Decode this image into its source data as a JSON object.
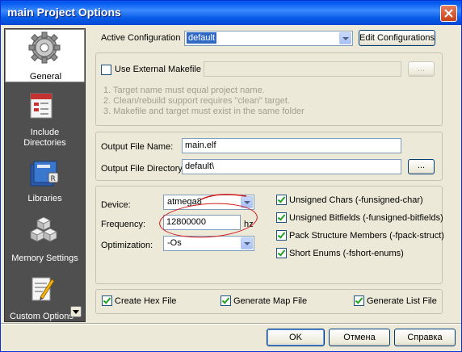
{
  "window": {
    "title": "main Project Options"
  },
  "sidebar": {
    "items": [
      {
        "label": "General",
        "icon": "gear-icon"
      },
      {
        "label": "Include Directories",
        "label_line1": "Include",
        "label_line2": "Directories",
        "icon": "include-directories-icon"
      },
      {
        "label": "Libraries",
        "icon": "libraries-icon"
      },
      {
        "label": "Memory Settings",
        "icon": "memory-settings-icon"
      },
      {
        "label": "Custom Options",
        "icon": "custom-options-icon"
      }
    ]
  },
  "config": {
    "active_label": "Active Configuration",
    "active_value": "default",
    "edit_button": "Edit Configurations"
  },
  "makefile": {
    "use_external_label": "Use External Makefile",
    "use_external_checked": false,
    "path_value": "",
    "browse_label": "...",
    "notes": [
      "1. Target name must equal project name.",
      "2. Clean/rebuild support requires  \"clean\" target.",
      "3. Makefile and target must exist in the same folder"
    ]
  },
  "output": {
    "file_name_label": "Output File Name:",
    "file_name_value": "main.elf",
    "directory_label": "Output File Directory:",
    "directory_value": "default\\",
    "browse_label": "..."
  },
  "device": {
    "device_label": "Device:",
    "device_value": "atmega8",
    "frequency_label": "Frequency:",
    "frequency_value": "12800000",
    "frequency_unit": "hz",
    "optimization_label": "Optimization:",
    "optimization_value": "-Os"
  },
  "compiler_flags": [
    {
      "label": "Unsigned Chars (-funsigned-char)",
      "checked": true
    },
    {
      "label": "Unsigned Bitfields (-funsigned-bitfields)",
      "checked": true
    },
    {
      "label": "Pack Structure Members (-fpack-struct)",
      "checked": true
    },
    {
      "label": "Short Enums (-fshort-enums)",
      "checked": true
    }
  ],
  "outputs_gen": [
    {
      "label": "Create Hex File",
      "checked": true
    },
    {
      "label": "Generate Map File",
      "checked": true
    },
    {
      "label": "Generate List File",
      "checked": true
    }
  ],
  "buttons": {
    "ok": "OK",
    "cancel": "Отмена",
    "help": "Справка"
  },
  "annotation_color": "#d21919"
}
